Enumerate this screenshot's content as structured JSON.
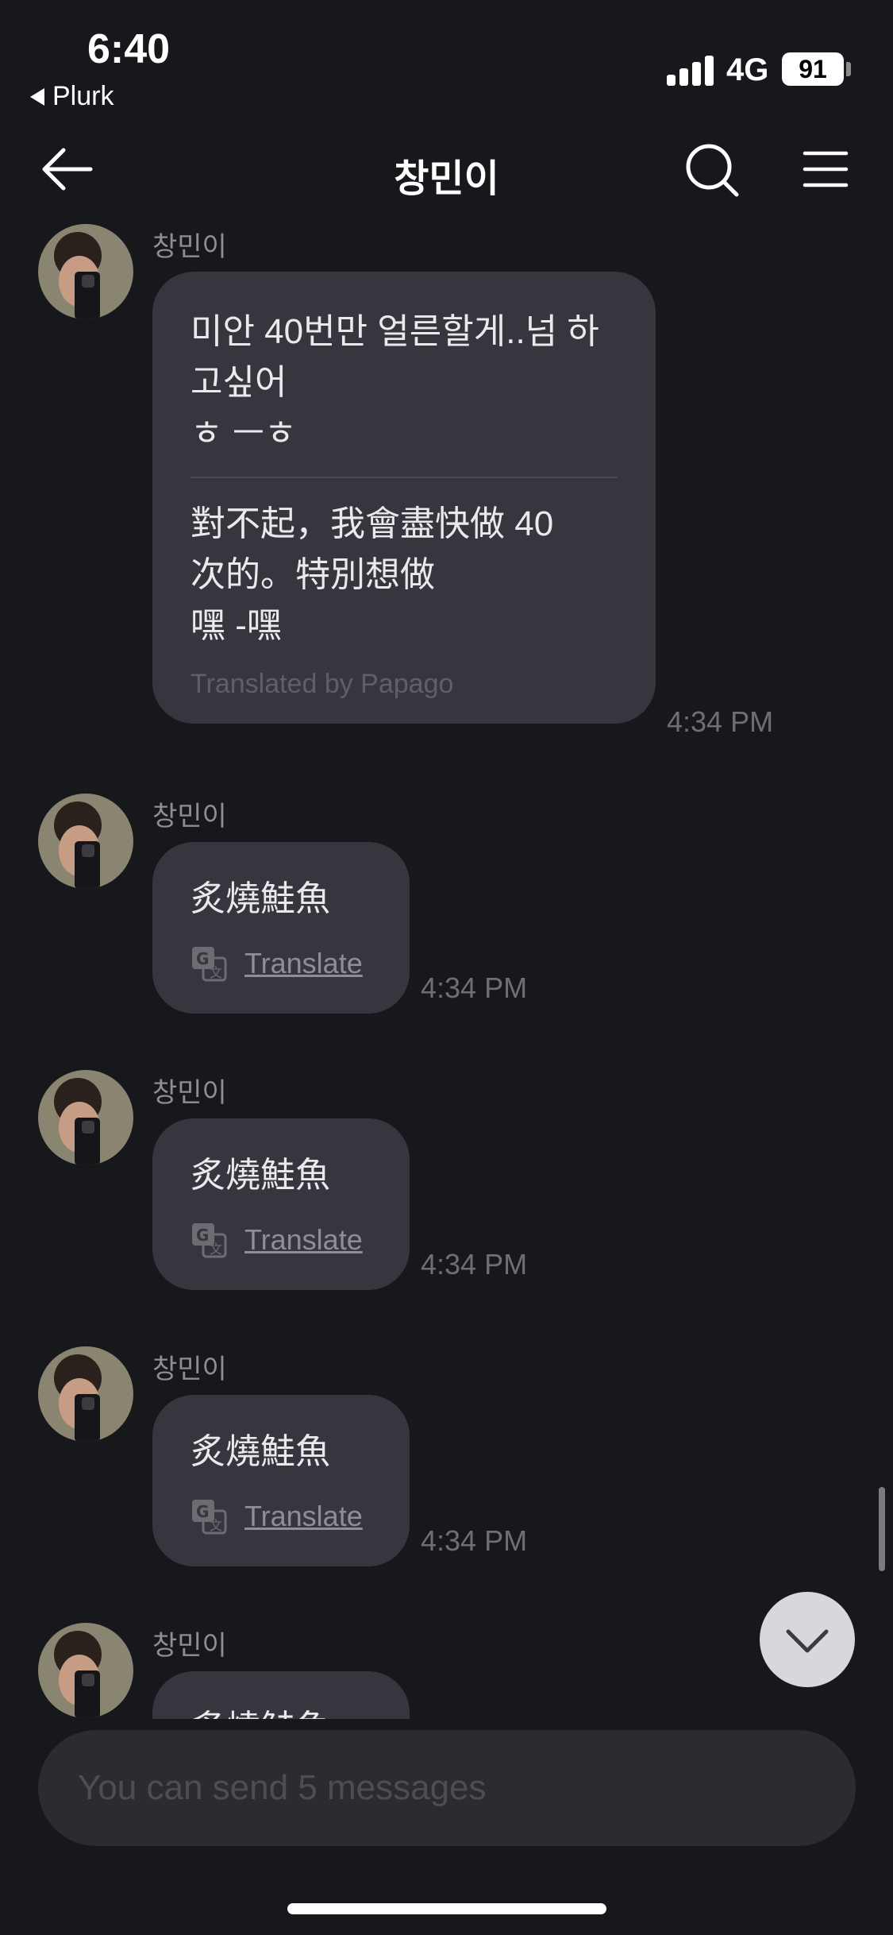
{
  "status": {
    "time": "6:40",
    "back_app": "Plurk",
    "network": "4G",
    "battery": "91"
  },
  "header": {
    "title": "창민이"
  },
  "messages": [
    {
      "sender": "창민이",
      "text": "미안 40번만 얼른할게..넘 하\n고싶어\n ㅎ ㅡㅎ",
      "translation": "對不起，我會盡快做 40\n次的。特別想做\n 嘿 -嘿",
      "credit": "Translated by Papago",
      "time": "4:34 PM"
    },
    {
      "sender": "창민이",
      "text": "炙燒鮭魚",
      "translate_label": "Translate",
      "time": "4:34 PM"
    },
    {
      "sender": "창민이",
      "text": "炙燒鮭魚",
      "translate_label": "Translate",
      "time": "4:34 PM"
    },
    {
      "sender": "창민이",
      "text": "炙燒鮭魚",
      "translate_label": "Translate",
      "time": "4:34 PM"
    },
    {
      "sender": "창민이",
      "text": "炙燒鮭魚"
    }
  ],
  "composer": {
    "placeholder": "You can send 5 messages"
  },
  "icons": [
    "back-arrow-icon",
    "search-icon",
    "menu-icon",
    "translate-icon",
    "chevron-down-icon"
  ]
}
